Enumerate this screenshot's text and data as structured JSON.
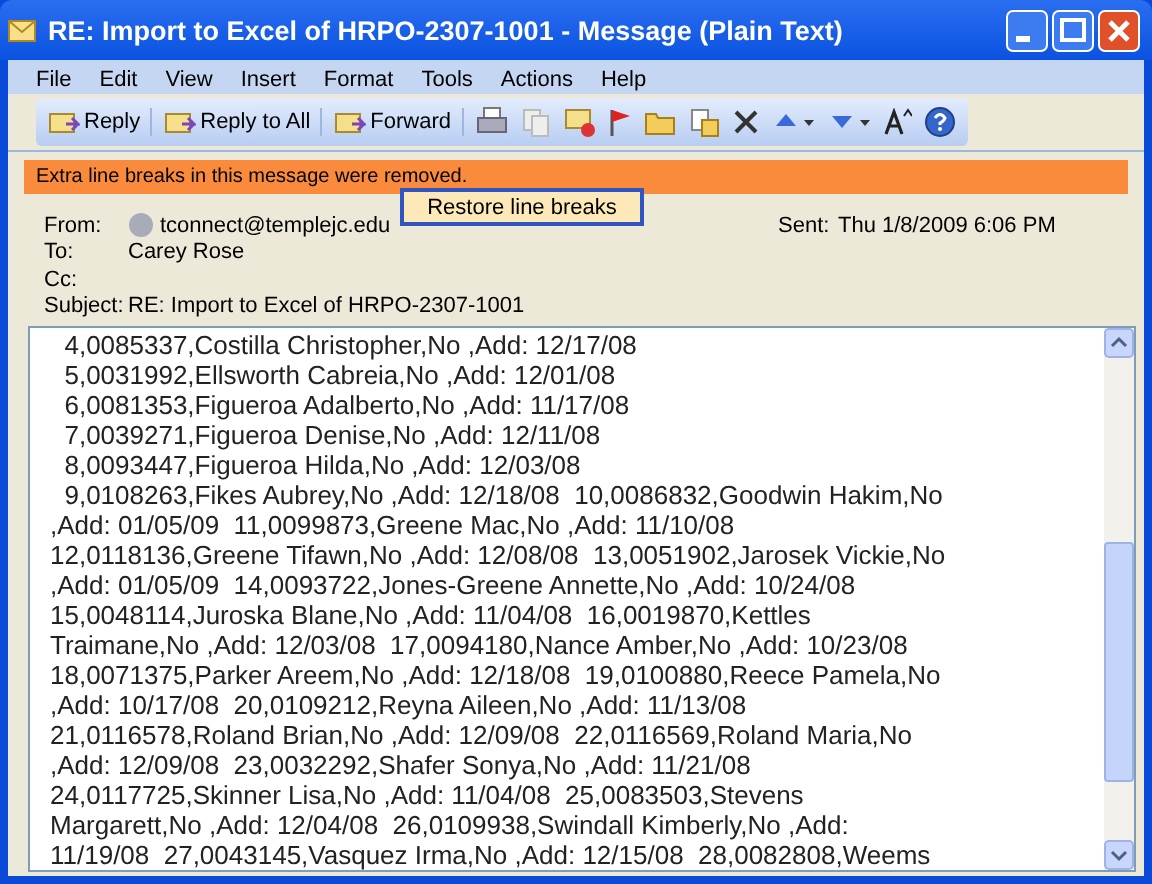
{
  "window": {
    "title": "RE: Import to Excel of HRPO-2307-1001 - Message (Plain Text)"
  },
  "menu": [
    "File",
    "Edit",
    "View",
    "Insert",
    "Format",
    "Tools",
    "Actions",
    "Help"
  ],
  "toolbar": [
    {
      "label": "Reply"
    },
    {
      "label": "Reply to All"
    },
    {
      "label": "Forward"
    }
  ],
  "infobar": {
    "text": "Extra line breaks in this message were removed.",
    "button": "Restore line breaks"
  },
  "header": {
    "from_label": "From:",
    "from": "tconnect@templejc.edu",
    "to_label": "To:",
    "to": "Carey Rose",
    "cc_label": "Cc:",
    "subject_label": "Subject:",
    "subject": "RE: Import to Excel of HRPO-2307-1001",
    "sent_label": "Sent:",
    "sent": "Thu 1/8/2009 6:06 PM"
  },
  "body": [
    "  4,0085337,Costilla Christopher,No ,Add: 12/17/08",
    "  5,0031992,Ellsworth Cabreia,No ,Add: 12/01/08",
    "  6,0081353,Figueroa Adalberto,No ,Add: 11/17/08",
    "  7,0039271,Figueroa Denise,No ,Add: 12/11/08",
    "  8,0093447,Figueroa Hilda,No ,Add: 12/03/08",
    "  9,0108263,Fikes Aubrey,No ,Add: 12/18/08  10,0086832,Goodwin Hakim,No",
    ",Add: 01/05/09  11,0099873,Greene Mac,No ,Add: 11/10/08",
    "12,0118136,Greene Tifawn,No ,Add: 12/08/08  13,0051902,Jarosek Vickie,No",
    ",Add: 01/05/09  14,0093722,Jones-Greene Annette,No ,Add: 10/24/08",
    "15,0048114,Juroska Blane,No ,Add: 11/04/08  16,0019870,Kettles",
    "Traimane,No ,Add: 12/03/08  17,0094180,Nance Amber,No ,Add: 10/23/08",
    "18,0071375,Parker Areem,No ,Add: 12/18/08  19,0100880,Reece Pamela,No",
    ",Add: 10/17/08  20,0109212,Reyna Aileen,No ,Add: 11/13/08",
    "21,0116578,Roland Brian,No ,Add: 12/09/08  22,0116569,Roland Maria,No",
    ",Add: 12/09/08  23,0032292,Shafer Sonya,No ,Add: 11/21/08",
    "24,0117725,Skinner Lisa,No ,Add: 11/04/08  25,0083503,Stevens",
    "Margarett,No ,Add: 12/04/08  26,0109938,Swindall Kimberly,No ,Add:",
    "11/19/08  27,0043145,Vasquez Irma,No ,Add: 12/15/08  28,0082808,Weems"
  ]
}
